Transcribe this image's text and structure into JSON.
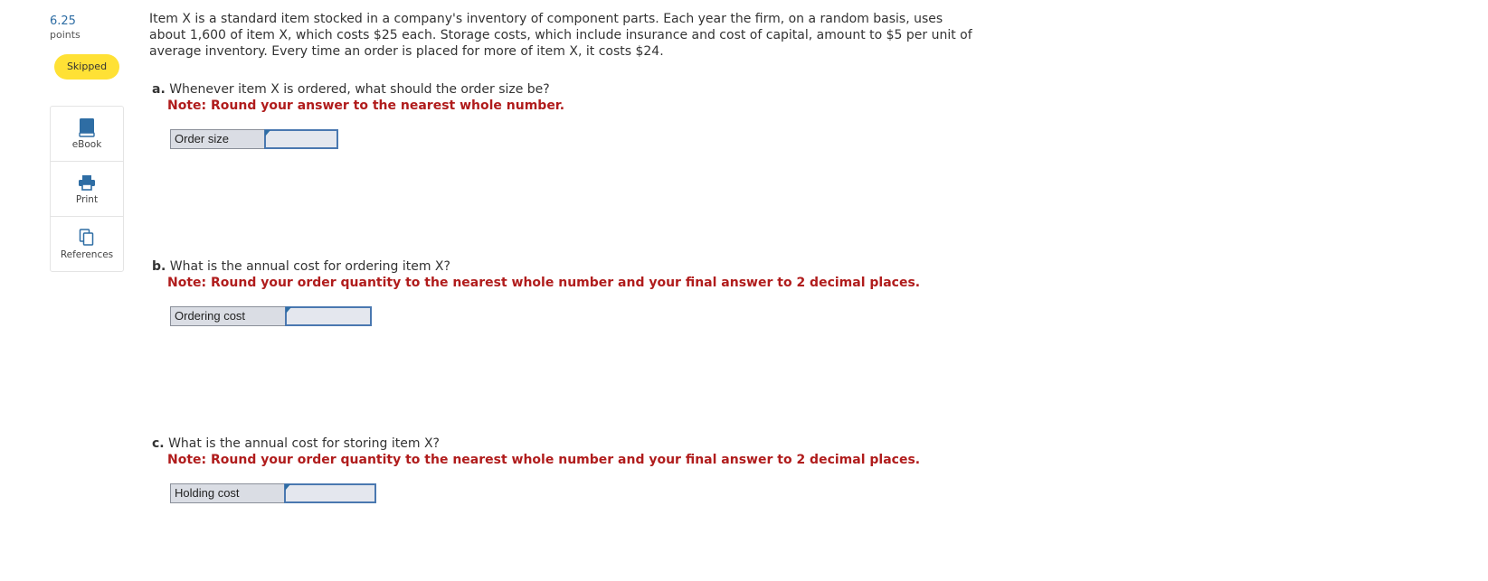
{
  "sidebar": {
    "points_value": "6.25",
    "points_label": "points",
    "status": "Skipped",
    "tools": [
      {
        "label": "eBook",
        "icon": "book-icon"
      },
      {
        "label": "Print",
        "icon": "printer-icon"
      },
      {
        "label": "References",
        "icon": "references-icon"
      }
    ]
  },
  "question": {
    "stem": "Item X is a standard item stocked in a company's inventory of component parts. Each year the firm, on a random basis, uses about 1,600 of item X, which costs $25 each. Storage costs, which include insurance and cost of capital, amount to $5 per unit of average inventory. Every time an order is placed for more of item X, it costs $24.",
    "parts": [
      {
        "letter": "a.",
        "text": "Whenever item X is ordered, what should the order size be?",
        "note": "Note: Round your answer to the nearest whole number.",
        "answer_label": "Order size",
        "answer_value": ""
      },
      {
        "letter": "b.",
        "text": "What is the annual cost for ordering item X?",
        "note": "Note: Round your order quantity to the nearest whole number and your final answer to 2 decimal places.",
        "answer_label": "Ordering cost",
        "answer_value": ""
      },
      {
        "letter": "c.",
        "text": "What is the annual cost for storing item X?",
        "note": "Note: Round your order quantity to the nearest whole number and your final answer to 2 decimal places.",
        "answer_label": "Holding cost",
        "answer_value": ""
      }
    ]
  },
  "colors": {
    "badge": "#ffe135",
    "note": "#b01c1c",
    "input_border": "#4a78b0",
    "icon": "#2e6da4"
  }
}
